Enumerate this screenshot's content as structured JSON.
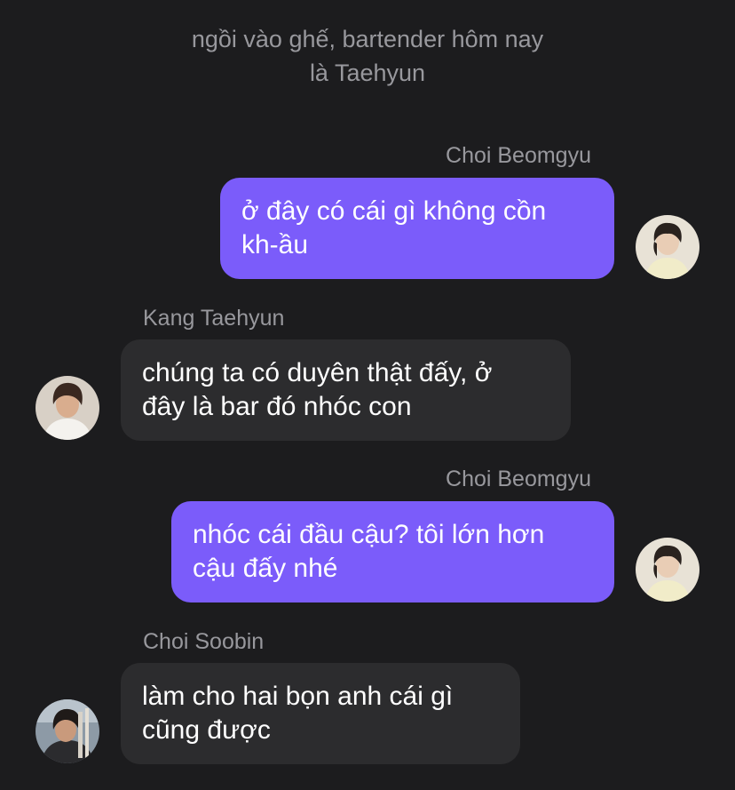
{
  "narration": {
    "line1": "ngồi vào ghế, bartender hôm nay",
    "line2": "là Taehyun"
  },
  "messages": [
    {
      "sender": "Choi Beomgyu",
      "side": "right",
      "lines": [
        "ở đây có cái gì không cồn",
        "kh-ầu"
      ],
      "avatar_icon": "beomgyu-avatar-icon"
    },
    {
      "sender": "Kang Taehyun",
      "side": "left",
      "lines": [
        "chúng ta có duyên thật đấy, ở",
        "đây là bar đó nhóc con"
      ],
      "avatar_icon": "taehyun-avatar-icon"
    },
    {
      "sender": "Choi Beomgyu",
      "side": "right",
      "lines": [
        "nhóc cái đầu cậu? tôi lớn hơn",
        "cậu đấy nhé"
      ],
      "avatar_icon": "beomgyu-avatar-icon"
    },
    {
      "sender": "Choi Soobin",
      "side": "left",
      "lines": [
        "làm cho hai bọn anh cái gì",
        "cũng được"
      ],
      "avatar_icon": "soobin-avatar-icon"
    }
  ],
  "colors": {
    "background": "#1c1c1e",
    "user_bubble": "#7b5cfa",
    "other_bubble": "#2c2c2e",
    "secondary_text": "#98989d",
    "message_text": "#ffffff"
  }
}
